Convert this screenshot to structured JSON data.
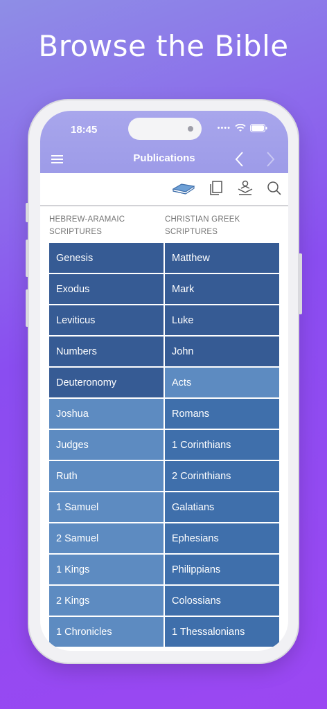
{
  "headline": "Browse the Bible",
  "status_bar": {
    "time": "18:45"
  },
  "nav": {
    "title": "Publications"
  },
  "icons": {
    "menu": "hamburger-icon",
    "back": "chevron-left-icon",
    "forward": "chevron-right-icon",
    "book": "open-book-icon",
    "copy": "copy-pages-icon",
    "reader": "reader-lectern-icon",
    "search": "search-icon"
  },
  "columns": {
    "hebrew_header": "HEBREW-ARAMAIC SCRIPTURES",
    "greek_header": "CHRISTIAN GREEK SCRIPTURES"
  },
  "hebrew_books": [
    {
      "name": "Genesis"
    },
    {
      "name": "Exodus"
    },
    {
      "name": "Leviticus"
    },
    {
      "name": "Numbers"
    },
    {
      "name": "Deuteronomy"
    },
    {
      "name": "Joshua"
    },
    {
      "name": "Judges"
    },
    {
      "name": "Ruth"
    },
    {
      "name": "1 Samuel"
    },
    {
      "name": "2 Samuel"
    },
    {
      "name": "1 Kings"
    },
    {
      "name": "2 Kings"
    },
    {
      "name": "1 Chronicles"
    }
  ],
  "greek_books": [
    {
      "name": "Matthew"
    },
    {
      "name": "Mark"
    },
    {
      "name": "Luke"
    },
    {
      "name": "John"
    },
    {
      "name": "Acts"
    },
    {
      "name": "Romans"
    },
    {
      "name": "1 Corinthians"
    },
    {
      "name": "2 Corinthians"
    },
    {
      "name": "Galatians"
    },
    {
      "name": "Ephesians"
    },
    {
      "name": "Philippians"
    },
    {
      "name": "Colossians"
    },
    {
      "name": "1 Thessalonians"
    }
  ],
  "colors": {
    "background_top": "#8e8ee6",
    "background_bottom": "#9b47f2",
    "nav_bar": "#a8a6ec",
    "book_dark": "#365b94",
    "book_mid": "#3f6fab",
    "book_light": "#5d8bc1",
    "active_icon": "#5b8fc9"
  }
}
